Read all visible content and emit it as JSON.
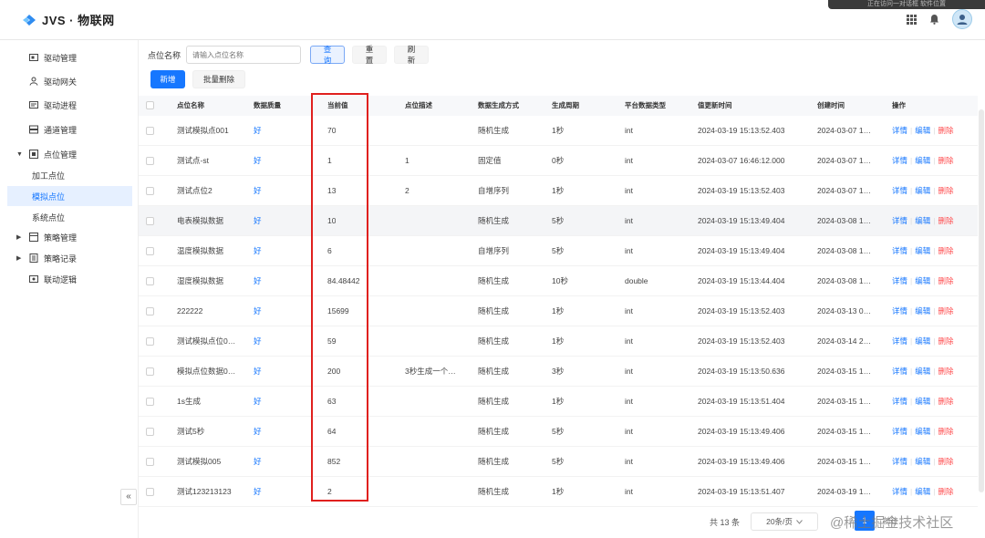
{
  "app": {
    "logo_text": "JVS · 物联网",
    "notice_text": "正在访问一对话框 软件位置"
  },
  "sidebar": {
    "items": [
      {
        "label": "驱动管理",
        "icon": "drive-icon"
      },
      {
        "label": "驱动网关",
        "icon": "gateway-icon"
      },
      {
        "label": "驱动进程",
        "icon": "process-icon"
      },
      {
        "label": "通道管理",
        "icon": "channel-icon"
      },
      {
        "label": "点位管理",
        "icon": "point-icon"
      },
      {
        "label": "加工点位"
      },
      {
        "label": "模拟点位"
      },
      {
        "label": "系统点位"
      },
      {
        "label": "策略管理",
        "icon": "strategy-icon"
      },
      {
        "label": "策略记录",
        "icon": "record-icon"
      },
      {
        "label": "联动逻辑",
        "icon": "linkage-icon"
      }
    ],
    "collapse_label": "«"
  },
  "filter": {
    "label": "点位名称",
    "placeholder": "请输入点位名称",
    "query": "查询",
    "reset": "重置",
    "refresh": "刷新"
  },
  "toolbar": {
    "add": "新增",
    "batch_delete": "批量删除"
  },
  "table": {
    "headers": [
      "点位名称",
      "数据质量",
      "当前值",
      "点位描述",
      "数据生成方式",
      "生成周期",
      "平台数据类型",
      "值更新时间",
      "创建时间",
      "操作"
    ],
    "ops": {
      "detail": "详情",
      "edit": "编辑",
      "delete": "删除"
    },
    "rows": [
      {
        "name": "测试模拟点001",
        "quality": "好",
        "value": "70",
        "desc": "",
        "method": "随机生成",
        "period": "1秒",
        "type": "int",
        "updated": "2024-03-19 15:13:52.403",
        "created": "2024-03-07 1…"
      },
      {
        "name": "测试点-st",
        "quality": "好",
        "value": "1",
        "desc": "1",
        "method": "固定值",
        "period": "0秒",
        "type": "int",
        "updated": "2024-03-07 16:46:12.000",
        "created": "2024-03-07 1…"
      },
      {
        "name": "测试点位2",
        "quality": "好",
        "value": "13",
        "desc": "2",
        "method": "自增序列",
        "period": "1秒",
        "type": "int",
        "updated": "2024-03-19 15:13:52.403",
        "created": "2024-03-07 1…"
      },
      {
        "name": "电表模拟数据",
        "quality": "好",
        "value": "10",
        "desc": "",
        "method": "随机生成",
        "period": "5秒",
        "type": "int",
        "updated": "2024-03-19 15:13:49.404",
        "created": "2024-03-08 1…"
      },
      {
        "name": "温度模拟数据",
        "quality": "好",
        "value": "6",
        "desc": "",
        "method": "自增序列",
        "period": "5秒",
        "type": "int",
        "updated": "2024-03-19 15:13:49.404",
        "created": "2024-03-08 1…"
      },
      {
        "name": "湿度模拟数据",
        "quality": "好",
        "value": "84.48442",
        "desc": "",
        "method": "随机生成",
        "period": "10秒",
        "type": "double",
        "updated": "2024-03-19 15:13:44.404",
        "created": "2024-03-08 1…"
      },
      {
        "name": "222222",
        "quality": "好",
        "value": "15699",
        "desc": "",
        "method": "随机生成",
        "period": "1秒",
        "type": "int",
        "updated": "2024-03-19 15:13:52.403",
        "created": "2024-03-13 0…"
      },
      {
        "name": "测试模拟点位0…",
        "quality": "好",
        "value": "59",
        "desc": "",
        "method": "随机生成",
        "period": "1秒",
        "type": "int",
        "updated": "2024-03-19 15:13:52.403",
        "created": "2024-03-14 2…"
      },
      {
        "name": "模拟点位数据0…",
        "quality": "好",
        "value": "200",
        "desc": "3秒生成一个…",
        "method": "随机生成",
        "period": "3秒",
        "type": "int",
        "updated": "2024-03-19 15:13:50.636",
        "created": "2024-03-15 1…"
      },
      {
        "name": "1s生成",
        "quality": "好",
        "value": "63",
        "desc": "",
        "method": "随机生成",
        "period": "1秒",
        "type": "int",
        "updated": "2024-03-19 15:13:51.404",
        "created": "2024-03-15 1…"
      },
      {
        "name": "测试5秒",
        "quality": "好",
        "value": "64",
        "desc": "",
        "method": "随机生成",
        "period": "5秒",
        "type": "int",
        "updated": "2024-03-19 15:13:49.406",
        "created": "2024-03-15 1…"
      },
      {
        "name": "测试模拟005",
        "quality": "好",
        "value": "852",
        "desc": "",
        "method": "随机生成",
        "period": "5秒",
        "type": "int",
        "updated": "2024-03-19 15:13:49.406",
        "created": "2024-03-15 1…"
      },
      {
        "name": "测试123213123",
        "quality": "好",
        "value": "2",
        "desc": "",
        "method": "随机生成",
        "period": "1秒",
        "type": "int",
        "updated": "2024-03-19 15:13:51.407",
        "created": "2024-03-19 1…"
      }
    ]
  },
  "pagination": {
    "total": "共 13 条",
    "page_size": "20条/页",
    "current": "1",
    "goto": "前往"
  },
  "watermark": "@稀土掘金技术社区",
  "colors": {
    "primary": "#1677ff",
    "danger": "#ff4d4f",
    "highlight": "#e0201e"
  }
}
